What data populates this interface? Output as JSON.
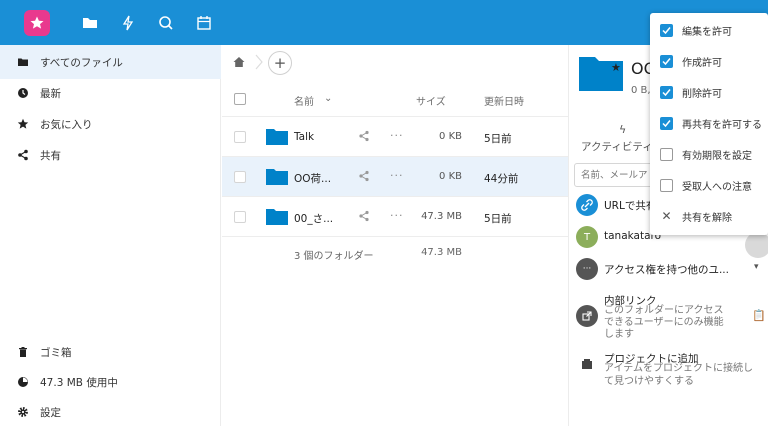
{
  "header": {
    "icons": [
      "files-icon",
      "activity-icon",
      "search-icon",
      "calendar-icon"
    ],
    "brand_color": "#1a8fd6"
  },
  "sidebar": {
    "items": [
      {
        "label": "すべてのファイル",
        "icon": "folder-icon",
        "active": true
      },
      {
        "label": "最新",
        "icon": "clock-icon"
      },
      {
        "label": "お気に入り",
        "icon": "star-icon"
      },
      {
        "label": "共有",
        "icon": "share-icon"
      }
    ],
    "bottom": [
      {
        "label": "ゴミ箱",
        "icon": "trash-icon"
      },
      {
        "label": "47.3 MB 使用中",
        "icon": "pie-icon"
      },
      {
        "label": "設定",
        "icon": "gear-icon"
      }
    ]
  },
  "files": {
    "add_label": "+",
    "columns": {
      "name": "名前",
      "size": "サイズ",
      "modified": "更新日時"
    },
    "sort_indicator": "⌄",
    "rows": [
      {
        "name": "Talk",
        "size": "0 KB",
        "modified": "5日前"
      },
      {
        "name": "OO荷...",
        "size": "0 KB",
        "modified": "44分前"
      },
      {
        "name": "00_さ...",
        "size": "47.3 MB",
        "modified": "5日前"
      }
    ],
    "summary": {
      "count": "3 個のフォルダー",
      "size": "47.3 MB"
    }
  },
  "panel": {
    "title": "OO",
    "subtitle": "0 B,",
    "tab_label": "アクティビティ",
    "search_placeholder": "名前、メールアド",
    "url_share": "URLで共有",
    "user": {
      "initial": "T",
      "name": "tanakataro",
      "color": "#8cae5b"
    },
    "others": "アクセス権を持つ他のユ...",
    "internal": {
      "title": "内部リンク",
      "desc1": "このフォルダーにアクセス",
      "desc2": "できるユーザーにのみ機能",
      "desc3": "します"
    },
    "project": {
      "title": "プロジェクトに追加",
      "desc1": "アイテムをプロジェクトに接続し",
      "desc2": "て見つけやすくする"
    }
  },
  "dropdown": {
    "items": [
      {
        "label": "編集を許可",
        "checked": true
      },
      {
        "label": "作成許可",
        "checked": true
      },
      {
        "label": "削除許可",
        "checked": true
      },
      {
        "label": "再共有を許可する",
        "checked": true
      },
      {
        "label": "有効期限を設定",
        "checked": false
      },
      {
        "label": "受取人への注意",
        "checked": false
      }
    ],
    "unshare": "共有を解除"
  }
}
